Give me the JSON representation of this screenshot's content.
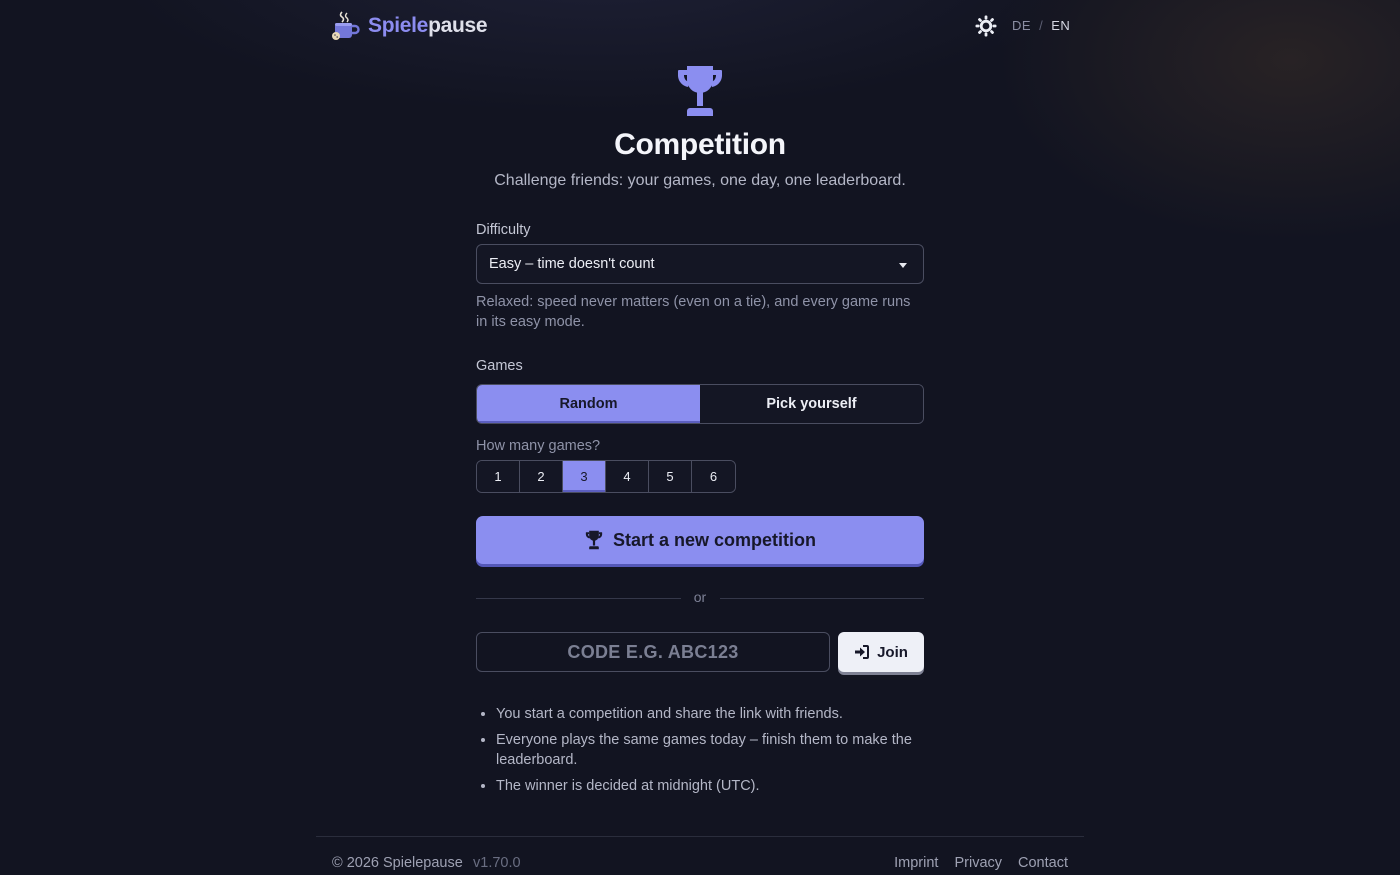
{
  "header": {
    "brand_part1": "Spiele",
    "brand_part2": "pause",
    "logo_icon": "coffee-mug-icon",
    "theme_icon": "sun-icon",
    "lang_de": "DE",
    "lang_sep": "/",
    "lang_en": "EN",
    "active_lang": "EN"
  },
  "main": {
    "hero_icon": "trophy-icon",
    "title": "Competition",
    "subtitle": "Challenge friends: your games, one day, one leaderboard.",
    "difficulty_label": "Difficulty",
    "difficulty_value": "Easy – time doesn't count",
    "difficulty_help": "Relaxed: speed never matters (even on a tie), and every game runs in its easy mode.",
    "games_label": "Games",
    "games_mode": {
      "options": [
        "Random",
        "Pick yourself"
      ],
      "selected": "Random"
    },
    "count_label": "How many games?",
    "count_options": [
      "1",
      "2",
      "3",
      "4",
      "5",
      "6"
    ],
    "count_selected": "3",
    "start_button": "Start a new competition",
    "divider_text": "or",
    "code_placeholder": "CODE E.G. ABC123",
    "code_value": "",
    "join_button": "Join",
    "info_items": [
      "You start a competition and share the link with friends.",
      "Everyone plays the same games today – finish them to make the leaderboard.",
      "The winner is decided at midnight (UTC)."
    ]
  },
  "footer": {
    "copyright": "© 2026 Spielepause",
    "version": "v1.70.0",
    "links": [
      "Imprint",
      "Privacy",
      "Contact"
    ]
  },
  "colors": {
    "accent": "#8b8ef0",
    "background": "#121421",
    "text": "#e8e9f0"
  }
}
